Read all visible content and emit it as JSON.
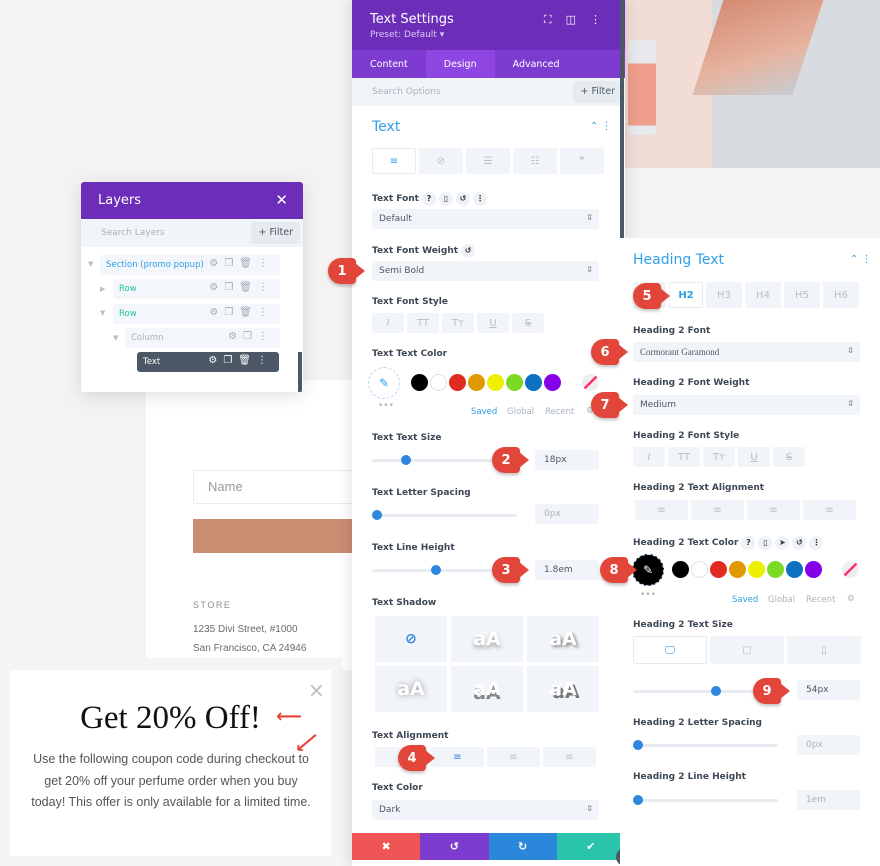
{
  "background_page": {
    "name_placeholder": "Name",
    "store_label": "STORE",
    "address_line1": "1235 Divi Street, #1000",
    "address_line2": "San Francisco, CA 24946",
    "button_color": "#c98d72"
  },
  "popup": {
    "title": "Get 20% Off!",
    "body": "Use the following coupon code during checkout to get 20% off your perfume order when you buy today! This offer is only available for a limited time.",
    "close_icon": "×"
  },
  "layers": {
    "title": "Layers",
    "search_placeholder": "Search Layers",
    "filter_label": "+ Filter",
    "items": [
      {
        "label": "Section (promo popup)",
        "type": "section",
        "color": "#2e9fe6"
      },
      {
        "label": "Row",
        "type": "row",
        "color": "#29c4a9"
      },
      {
        "label": "Row",
        "type": "row",
        "color": "#29c4a9"
      },
      {
        "label": "Column",
        "type": "column",
        "color": "#aab3bd"
      },
      {
        "label": "Text",
        "type": "module",
        "selected": true
      }
    ]
  },
  "settings": {
    "title": "Text Settings",
    "preset": "Preset: Default ▾",
    "tabs": [
      "Content",
      "Design",
      "Advanced"
    ],
    "active_tab": "Design",
    "search_placeholder": "Search Options",
    "filter_label": "+ Filter",
    "section_title": "Text",
    "text_font_label": "Text Font",
    "text_font_value": "Default",
    "text_font_weight_label": "Text Font Weight",
    "text_font_weight_value": "Semi Bold",
    "text_font_style_label": "Text Font Style",
    "font_style_buttons": [
      "I",
      "TT",
      "Tт",
      "U",
      "S"
    ],
    "text_color_label": "Text Text Color",
    "swatches": [
      "#000000",
      "#ffffff",
      "#e02b20",
      "#e09900",
      "#edf000",
      "#7cda24",
      "#0c71c3",
      "#8300e9"
    ],
    "color_tabs": [
      "Saved",
      "Global",
      "Recent"
    ],
    "text_size_label": "Text Text Size",
    "text_size_value": "18px",
    "text_size_fraction": 0.2,
    "letter_spacing_label": "Text Letter Spacing",
    "letter_spacing_value": "0px",
    "line_height_label": "Text Line Height",
    "line_height_value": "1.8em",
    "line_height_fraction": 0.41,
    "text_shadow_label": "Text Shadow",
    "shadow_sample": "aA",
    "text_alignment_label": "Text Alignment",
    "active_alignment": "center",
    "text_color_scheme_label": "Text Color",
    "text_color_scheme_value": "Dark",
    "footer_colors": {
      "cancel": "#ef5555",
      "undo": "#7e3bd0",
      "redo": "#2b87da",
      "save": "#29c4a9"
    }
  },
  "heading": {
    "section_title": "Heading Text",
    "tabs": [
      "H2",
      "H3",
      "H4",
      "H5",
      "H6"
    ],
    "active_tab": "H2",
    "font_label": "Heading 2 Font",
    "font_value": "Cormorant Garamond",
    "weight_label": "Heading 2 Font Weight",
    "weight_value": "Medium",
    "style_label": "Heading 2 Font Style",
    "alignment_label": "Heading 2 Text Alignment",
    "color_label": "Heading 2 Text Color",
    "selected_color": "#000000",
    "size_label": "Heading 2 Text Size",
    "size_value": "54px",
    "size_fraction": 0.54,
    "letter_spacing_label": "Heading 2 Letter Spacing",
    "letter_spacing_value": "0px",
    "line_height_label": "Heading 2 Line Height",
    "line_height_value": "1em"
  },
  "markers": [
    "1",
    "2",
    "3",
    "4",
    "5",
    "6",
    "7",
    "8",
    "9"
  ]
}
